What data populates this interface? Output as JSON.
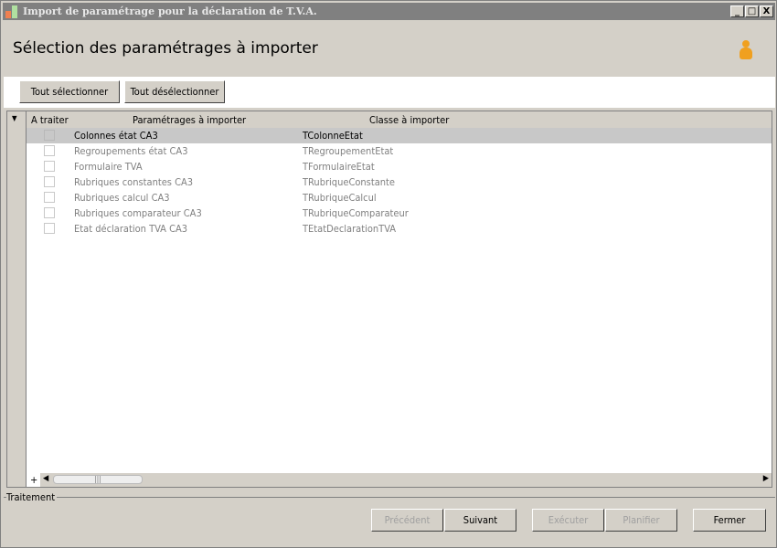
{
  "window": {
    "title": "Import de paramétrage pour la déclaration de T.V.A.",
    "minimize": "_",
    "maximize": "□",
    "close": "X"
  },
  "heading": "Sélection des paramétrages à importer",
  "toolbar": {
    "select_all": "Tout sélectionner",
    "deselect_all": "Tout désélectionner"
  },
  "grid": {
    "columns": [
      "A traiter",
      "Paramétrages à importer",
      "Classe à importer"
    ],
    "rows": [
      {
        "name": "Colonnes état CA3",
        "class": "TColonneEtat",
        "selected": true
      },
      {
        "name": "Regroupements état CA3",
        "class": "TRegroupementEtat"
      },
      {
        "name": "Formulaire TVA",
        "class": "TFormulaireEtat"
      },
      {
        "name": "Rubriques constantes CA3",
        "class": "TRubriqueConstante"
      },
      {
        "name": "Rubriques calcul CA3",
        "class": "TRubriqueCalcul"
      },
      {
        "name": "Rubriques comparateur CA3",
        "class": "TRubriqueComparateur"
      },
      {
        "name": "Etat déclaration TVA CA3",
        "class": "TEtatDeclarationTVA"
      }
    ],
    "add": "+"
  },
  "section": "Traitement",
  "footer": {
    "previous": "Précédent",
    "next": "Suivant",
    "execute": "Exécuter",
    "schedule": "Planifier",
    "close": "Fermer"
  }
}
